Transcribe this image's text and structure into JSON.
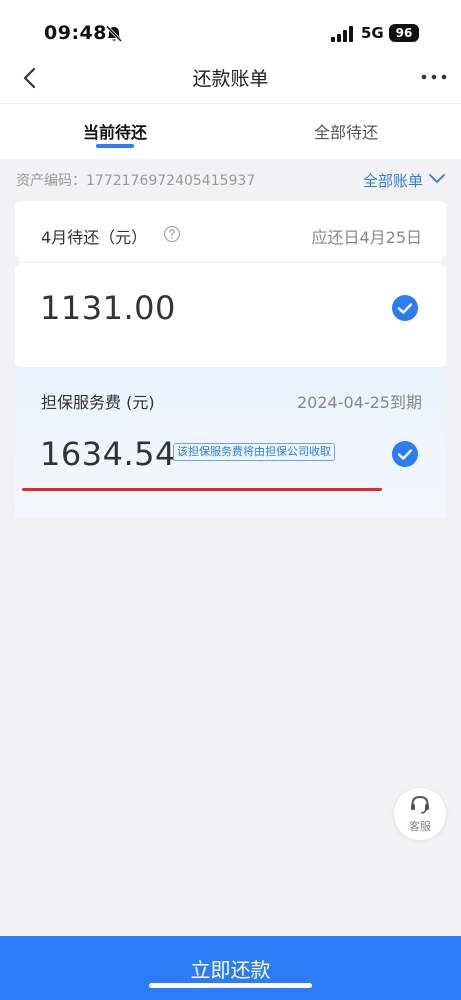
{
  "status_bar": {
    "time": "09:48",
    "network": "5G",
    "battery": "96"
  },
  "nav": {
    "title": "还款账单"
  },
  "tabs": [
    {
      "label": "当前待还",
      "active": true
    },
    {
      "label": "全部待还",
      "active": false
    }
  ],
  "asset": {
    "label": "资产编码：",
    "number": "1772176972405415937"
  },
  "all_bill_link": "全部账单",
  "installment": {
    "title": "4月待还（元）",
    "due": "应还日4月25日",
    "amount": "1131.00",
    "checked": true
  },
  "guarantee_fee": {
    "title": "担保服务费 (元)",
    "due": "2024-04-25到期",
    "amount": "1634.54",
    "tag": "该担保服务费将由担保公司收取",
    "checked": true
  },
  "customer_service": {
    "label": "客服"
  },
  "pay_button": {
    "label": "立即还款"
  },
  "colors": {
    "accent": "#2b7cf6",
    "annotation": "#e02b2b",
    "background": "#f2f2f4"
  },
  "icons": [
    "bell-mute-icon",
    "signal-icon",
    "back-icon",
    "more-icon",
    "help-icon",
    "chevron-down-icon",
    "check-icon",
    "headset-icon"
  ]
}
